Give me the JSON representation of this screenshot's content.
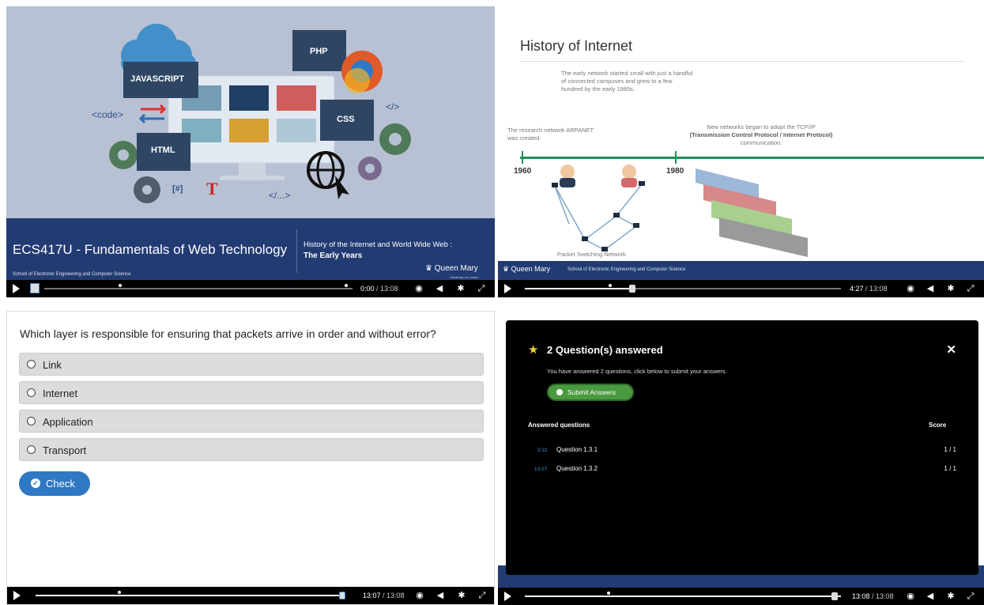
{
  "panel1": {
    "slide_tags": {
      "javascript": "JAVASCRIPT",
      "php": "PHP",
      "css": "CSS",
      "html": "HTML",
      "code": "<code>",
      "close_tag": "</>",
      "bracket_hash": "[#]",
      "t": "T",
      "ellipsis_tag": "</...>"
    },
    "course_title": "ECS417U - Fundamentals of Web Technology",
    "school": "School of Electronic Engineering and Computer Science",
    "lecture_line1": "History of the Internet and World Wide Web :",
    "lecture_line2": "The Early Years",
    "university": "Queen Mary",
    "university_sub": "University of London",
    "controls": {
      "current": "0:00",
      "total": "13:08",
      "progress": 0.0
    }
  },
  "panel2": {
    "title": "History of Internet",
    "note_top": "The early network started small with just a handful of connected campuses and grew to a few hundred by the early 1980s.",
    "note_left": "The research network ARPANET was created.",
    "note_right_1": "New networks began to adopt the TCP/IP",
    "note_right_2": "(Transmission Control Protocol / Internet Protocol)",
    "note_right_3": "communication.",
    "year_1": "1960",
    "year_2": "1980",
    "diagram_label": "Packet Switching Network",
    "university": "Queen Mary",
    "school": "School of Electronic Engineering and Computer Science",
    "controls": {
      "current": "4:27",
      "total": "13:08",
      "progress": 0.339
    }
  },
  "panel3": {
    "question": "Which layer is responsible for ensuring that packets arrive in order and without error?",
    "options": [
      "Link",
      "Internet",
      "Application",
      "Transport"
    ],
    "check_label": "Check",
    "controls": {
      "current": "13:07",
      "total": "13:08",
      "progress": 0.999
    }
  },
  "panel4": {
    "modal_title": "2 Question(s) answered",
    "info": "You have answered 2 questions, click below to submit your answers.",
    "submit_label": "Submit Answers",
    "col_questions": "Answered questions",
    "col_score": "Score",
    "rows": [
      {
        "time": "3:32",
        "question": "Question 1.3.1",
        "score": "1 / 1"
      },
      {
        "time": "13:07",
        "question": "Question 1.3.2",
        "score": "1 / 1"
      }
    ],
    "controls": {
      "current": "13:08",
      "total": "13:08",
      "progress": 1.0
    }
  },
  "icons": [
    "play-icon",
    "volume-icon",
    "gear-icon",
    "fullscreen-icon",
    "speed-icon",
    "close-icon",
    "star-icon",
    "check-circle-icon",
    "crown-icon",
    "globe-cursor-icon"
  ],
  "colors": {
    "navy": "#223b73",
    "green": "#1e8f55",
    "button_blue": "#2f78c4",
    "submit_green": "#4a9a3f",
    "star": "#f2d338"
  }
}
